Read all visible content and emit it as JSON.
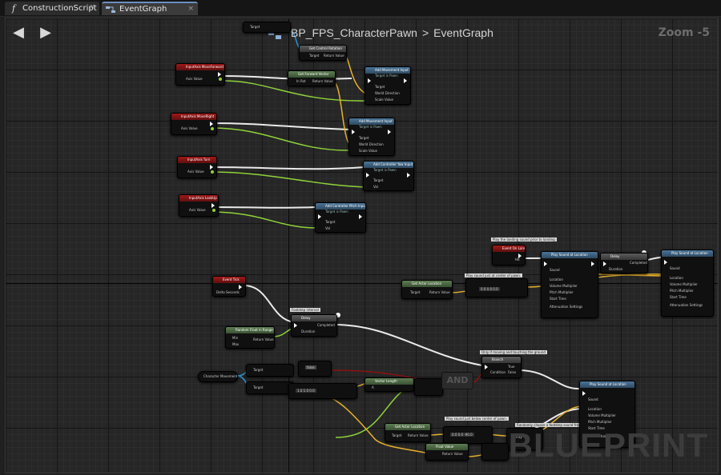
{
  "tabs": [
    {
      "label": "ConstructionScript",
      "icon": "function-icon",
      "close": "×"
    },
    {
      "label": "EventGraph",
      "icon": "graph-icon",
      "close": "×"
    }
  ],
  "toolbar": {
    "back": "◀",
    "forward": "▶"
  },
  "breadcrumb": {
    "blueprint": "BP_FPS_CharacterPawn",
    "separator": ">",
    "graph": "EventGraph"
  },
  "zoom": "Zoom -5",
  "watermark": "BLUEPRINT",
  "nodes": {
    "input_move_forward": {
      "title": "InputAxis MoveForward",
      "pin": "Axis Value"
    },
    "input_move_right": {
      "title": "InputAxis MoveRight",
      "pin": "Axis Value"
    },
    "input_turn": {
      "title": "InputAxis Turn",
      "pin": "Axis Value"
    },
    "input_lookup": {
      "title": "InputAxis LookUp",
      "pin": "Axis Value"
    },
    "get_control_rotation": {
      "title": "Get Control Rotation",
      "pin_target": "Target",
      "pin_return": "Return Value"
    },
    "get_forward_vector": {
      "title": "Get Forward Vector",
      "pin_in": "In Rot",
      "pin_return": "Return Value"
    },
    "add_movement_input_1": {
      "title": "Add Movement Input",
      "sub": "Target is Pawn",
      "pins": [
        "Target",
        "World Direction",
        "Scale Value"
      ]
    },
    "add_movement_input_2": {
      "title": "Add Movement Input",
      "sub": "Target is Pawn",
      "pins": [
        "Target",
        "World Direction",
        "Scale Value"
      ]
    },
    "add_yaw_input": {
      "title": "Add Controller Yaw Input",
      "sub": "Target is Pawn",
      "pins": [
        "Target",
        "Val"
      ]
    },
    "add_pitch_input": {
      "title": "Add Controller Pitch Input",
      "sub": "Target is Pawn",
      "pins": [
        "Target",
        "Val"
      ]
    },
    "event_tick": {
      "title": "Event Tick",
      "pin": "Delta Seconds"
    },
    "random_float": {
      "title": "Random Float in Range",
      "pins": [
        "Min",
        "Max"
      ],
      "ret": "Return Value"
    },
    "delay_1": {
      "title": "Delay",
      "pins": [
        "Duration"
      ],
      "out": "Completed"
    },
    "character_movement": {
      "title": "Character Movement",
      "pins": [
        "Target",
        "Target"
      ]
    },
    "get_actor_location_1": {
      "title": "Get Actor Location",
      "pins": [
        "Target"
      ],
      "ret": "Return Value"
    },
    "get_actor_location_2": {
      "title": "Get Actor Location",
      "pins": [
        "Target"
      ],
      "ret": "Return Value"
    },
    "event_landed": {
      "title": "Event On Landed",
      "pin": "Hit"
    },
    "play_sound_1": {
      "title": "Play Sound at Location",
      "pins": [
        "Sound",
        "Location",
        "Volume Multiplier",
        "Pitch Multiplier",
        "Start Time",
        "Attenuation Settings"
      ]
    },
    "play_sound_2": {
      "title": "Play Sound at Location",
      "pins": [
        "Sound",
        "Location",
        "Volume Multiplier",
        "Pitch Multiplier",
        "Start Time",
        "Attenuation Settings"
      ]
    },
    "play_sound_3": {
      "title": "Play Sound at Location",
      "pins": [
        "Sound",
        "Location",
        "Volume Multiplier",
        "Pitch Multiplier",
        "Start Time",
        "Attenuation Settings"
      ]
    },
    "delay_2": {
      "title": "Delay",
      "pins": [
        "Duration"
      ],
      "out": "Completed"
    },
    "branch": {
      "title": "Branch",
      "pins": [
        "Condition"
      ],
      "outs": [
        "True",
        "False"
      ]
    },
    "vector_length": {
      "title": "Vector Length",
      "pins": [
        "A"
      ],
      "ret": "Return Value"
    },
    "and_node": {
      "title": "AND"
    },
    "float_value": {
      "title": "Float Value",
      "ret": "Return Value"
    }
  },
  "comments": {
    "c1": "Play the landing sound prior to landing",
    "c2": "Play sound just at center of pawn.",
    "c3": "Footstep interval",
    "c4": "Only if moving and touching the ground",
    "c5": "Play sound just below center of pawn.",
    "c6": "Randomly choose a footstep sound from collection"
  },
  "colors": {
    "exec": "#ffffff",
    "float": "#8fd23a",
    "vector": "#e6b12d",
    "object": "#2b95d6",
    "bool": "#8c1111"
  }
}
